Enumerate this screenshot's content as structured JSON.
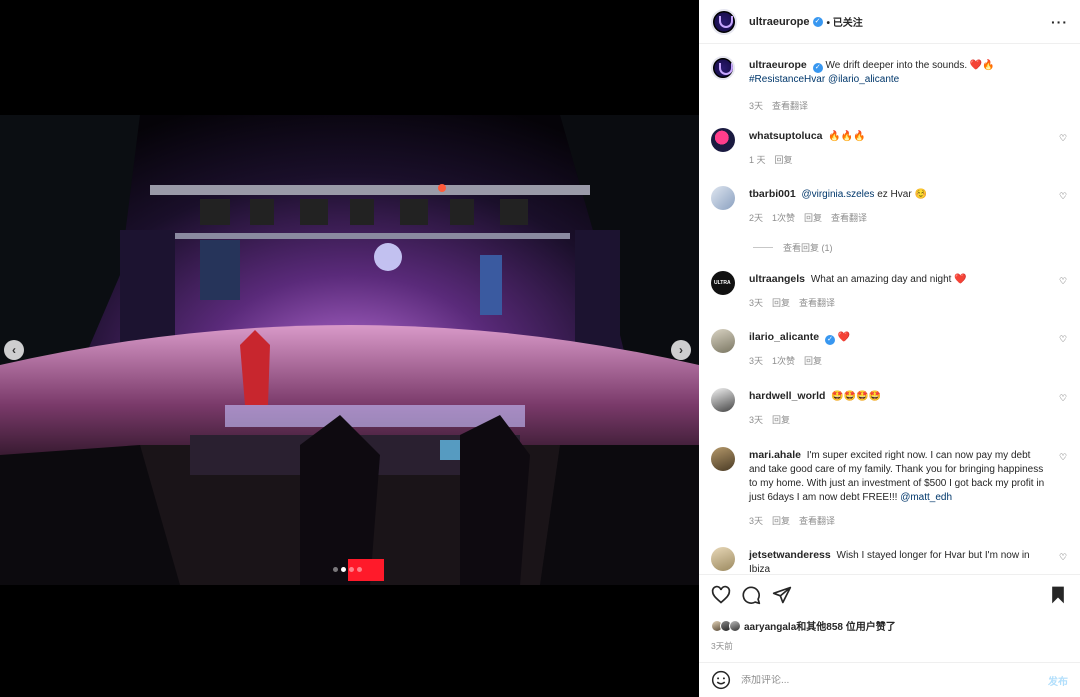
{
  "post": {
    "username": "ultraeurope",
    "follow_state": "已关注",
    "caption_text": "We drift deeper into the sounds. ❤️🔥",
    "caption_hashtag": "#ResistanceHvar",
    "caption_mention": "@ilario_alicante",
    "caption_age": "3天",
    "caption_translate": "查看翻译"
  },
  "comments": [
    {
      "user": "whatsuptoluca",
      "text": "🔥🔥🔥",
      "mention": "",
      "age": "1 天",
      "likes": "",
      "reply": "回复",
      "translate": ""
    },
    {
      "user": "tbarbi001",
      "mention": "@virginia.szeles",
      "text": "ez Hvar ☺️",
      "age": "2天",
      "likes": "1次赞",
      "reply": "回复",
      "translate": "查看翻译"
    },
    {
      "user": "ultraangels",
      "text": "What an amazing day and night ❤️",
      "mention": "",
      "age": "3天",
      "likes": "",
      "reply": "回复",
      "translate": "查看翻译"
    },
    {
      "user": "ilario_alicante",
      "text": "❤️",
      "mention": "",
      "age": "3天",
      "likes": "1次赞",
      "reply": "回复",
      "translate": ""
    },
    {
      "user": "hardwell_world",
      "text": "🤩🤩🤩🤩",
      "mention": "",
      "age": "3天",
      "likes": "",
      "reply": "回复",
      "translate": ""
    },
    {
      "user": "mari.ahale",
      "text": "I'm super excited right now. I can now pay my debt and take good care of my family. Thank you for bringing happiness to my home. With just an investment of $500 I got back my profit in just 6days I am now debt FREE!!!",
      "mention": "@matt_edh",
      "age": "3天",
      "likes": "",
      "reply": "回复",
      "translate": "查看翻译"
    },
    {
      "user": "jetsetwanderess",
      "text": "Wish I stayed longer for Hvar but I'm now in Ibiza",
      "mention": "",
      "age": "",
      "likes": "",
      "reply": "",
      "translate": ""
    }
  ],
  "view_replies": "查看回复 (1)",
  "likes_summary": "aaryangala和其他858 位用户赞了",
  "post_time": "3天前",
  "add_comment": {
    "placeholder": "添加评论...",
    "post_label": "发布"
  },
  "icons": {
    "more": "more-icon",
    "verified": "verified-icon",
    "heart": "heart-icon",
    "comment": "comment-icon",
    "share": "share-icon",
    "save": "bookmark-icon",
    "emoji": "emoji-icon",
    "prev": "chevron-left-icon",
    "next": "chevron-right-icon"
  },
  "colors": {
    "link": "#00376b",
    "verified": "#3897f0",
    "muted": "#8e8e8e",
    "post_button": "#b2dffc"
  },
  "carousel": {
    "count": 4,
    "active_index": 1
  }
}
